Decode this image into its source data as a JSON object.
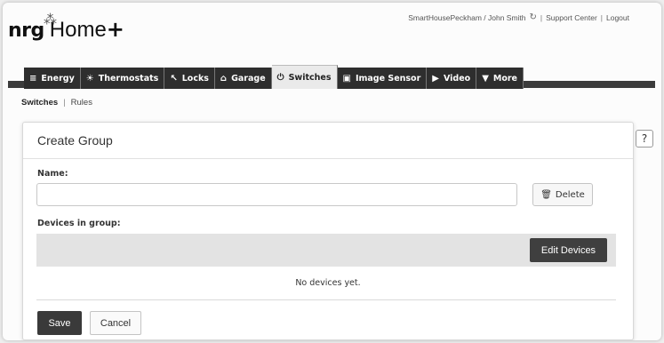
{
  "logo": {
    "brand": "nrg",
    "spark": "*",
    "product": "Home",
    "plus": "+"
  },
  "header_links": {
    "account": "SmartHousePeckham / John Smith",
    "refresh_icon": "refresh-icon",
    "support": "Support Center",
    "logout": "Logout",
    "sep": "|"
  },
  "tabs": [
    {
      "label": "Energy",
      "icon": "bar-chart-icon",
      "glyph": "≡"
    },
    {
      "label": "Thermostats",
      "icon": "thermostat-icon",
      "glyph": "☀"
    },
    {
      "label": "Locks",
      "icon": "key-icon",
      "glyph": "↖"
    },
    {
      "label": "Garage",
      "icon": "garage-icon",
      "glyph": "⌂"
    },
    {
      "label": "Switches",
      "icon": "power-icon",
      "glyph": "⏻",
      "active": true
    },
    {
      "label": "Image Sensor",
      "icon": "camera-icon",
      "glyph": "▣"
    },
    {
      "label": "Video",
      "icon": "video-icon",
      "glyph": "▶"
    },
    {
      "label": "More",
      "icon": "caret-down-icon",
      "glyph": "▼"
    }
  ],
  "subnav": {
    "current": "Switches",
    "sep": "|",
    "rules": "Rules"
  },
  "panel": {
    "title": "Create Group",
    "name_label": "Name:",
    "name_value": "",
    "delete_label": "Delete",
    "devices_label": "Devices in group:",
    "edit_devices_label": "Edit Devices",
    "empty_message": "No devices yet.",
    "save_label": "Save",
    "cancel_label": "Cancel"
  },
  "help": {
    "label": "?"
  }
}
